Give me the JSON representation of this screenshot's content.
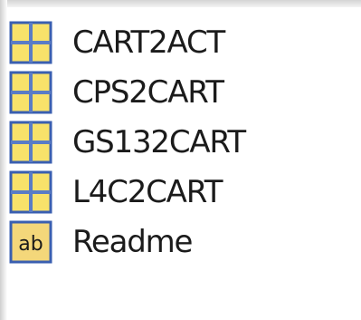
{
  "file_list": {
    "items": [
      {
        "label": "CART2ACT",
        "icon": "table-icon"
      },
      {
        "label": "CPS2CART",
        "icon": "table-icon"
      },
      {
        "label": "GS132CART",
        "icon": "table-icon"
      },
      {
        "label": "L4C2CART",
        "icon": "table-icon"
      },
      {
        "label": "Readme",
        "icon": "text-icon",
        "icon_text": "ab"
      }
    ]
  },
  "colors": {
    "icon_fill": "#f8e26a",
    "icon_border": "#3a5fb0",
    "icon_grid": "#5a7cc6",
    "text_icon_fill": "#f4d77a",
    "label_text": "#1b1b1b"
  }
}
